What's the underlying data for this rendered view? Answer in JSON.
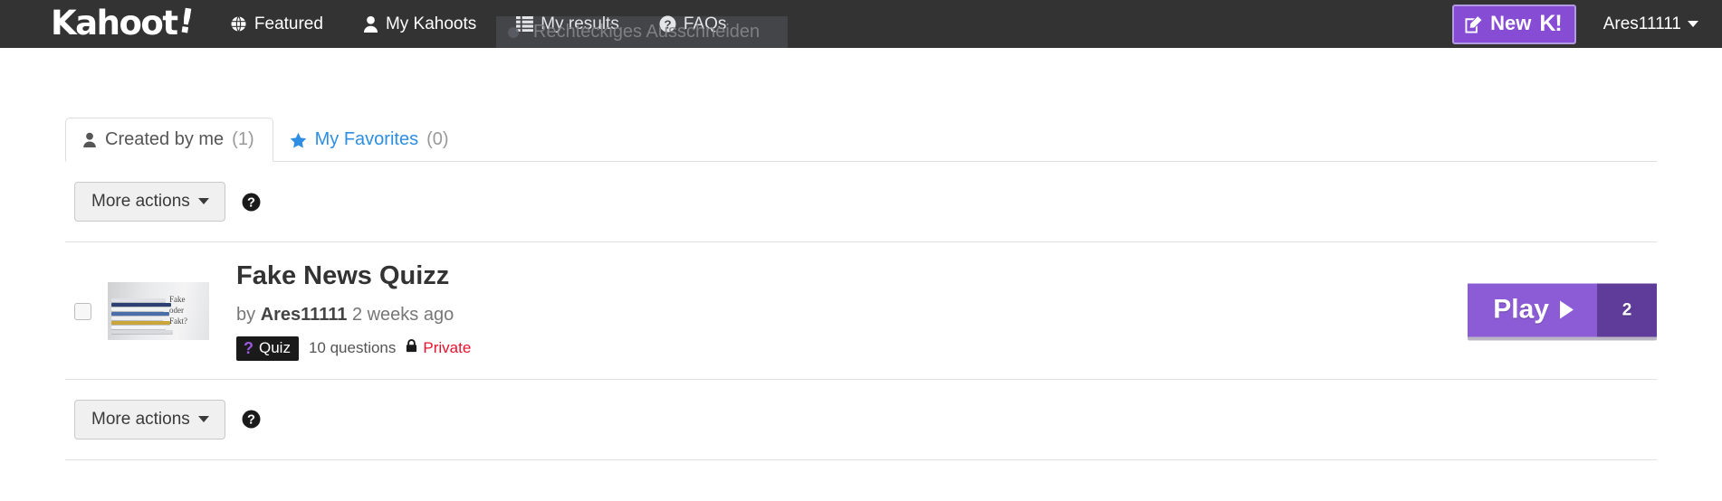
{
  "header": {
    "logo_text": "Kahoot",
    "logo_bang": "!",
    "nav": [
      {
        "label": "Featured",
        "icon": "globe-icon"
      },
      {
        "label": "My Kahoots",
        "icon": "user-icon"
      },
      {
        "label": "My results",
        "icon": "list-icon"
      },
      {
        "label": "FAQs",
        "icon": "question-circle-icon"
      }
    ],
    "new_button": {
      "label": "New",
      "k_glyph": "K!",
      "icon": "pencil-square-icon"
    },
    "username": "Ares11111",
    "bg_color": "#333333",
    "accent_color": "#864cd4"
  },
  "overlay": {
    "text": "Rechteckiges Ausschneiden"
  },
  "tabs": [
    {
      "label": "Created by me",
      "count": "(1)",
      "icon": "user-icon",
      "active": true
    },
    {
      "label": "My Favorites",
      "count": "(0)",
      "icon": "star-icon",
      "active": false
    }
  ],
  "toolbar": {
    "more_actions_label": "More actions",
    "help_icon": "question-circle-icon"
  },
  "kahoot": {
    "title": "Fake News Quizz",
    "by_prefix": "by",
    "author": "Ares11111",
    "time_ago": "2 weeks ago",
    "badge": "Quiz",
    "badge_mark": "?",
    "questions": "10 questions",
    "visibility": "Private",
    "visibility_color": "#e8112d",
    "thumbnail_caption_1": "Fake",
    "thumbnail_caption_2": "oder",
    "thumbnail_caption_3": "Fakt?",
    "play_label": "Play",
    "play_count": "2",
    "play_color": "#8b5cd6",
    "play_count_color": "#5f3c9a"
  },
  "bottom_toolbar": {
    "more_actions_label": "More actions",
    "help_icon": "question-circle-icon"
  }
}
